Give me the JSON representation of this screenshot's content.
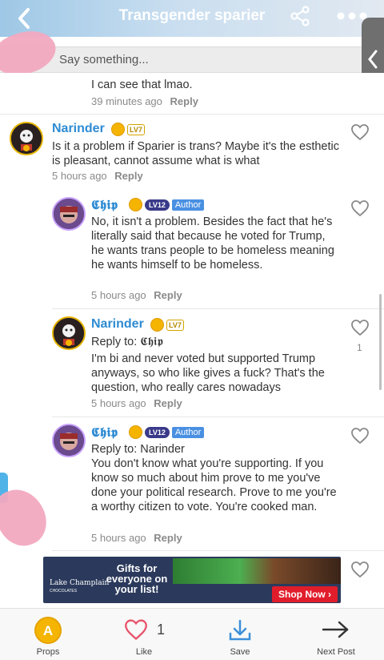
{
  "header": {
    "title": "Transgender sparier"
  },
  "composer": {
    "placeholder": "Say something..."
  },
  "comments": [
    {
      "text": "I can see that lmao.",
      "time": "39 minutes ago",
      "reply": "Reply"
    },
    {
      "username": "Narinder",
      "level": "LV7",
      "text": "Is it a problem if Sparier is trans? Maybe it's the esthetic is pleasant, cannot assume what is what",
      "time": "5 hours ago",
      "reply": "Reply"
    },
    {
      "username": "𝕮𝖍𝖎𝖕",
      "level": "LV12",
      "badge": "Author",
      "text": "No, it isn't a problem. Besides the fact that he's literally said that because he voted for Trump, he wants trans people to be homeless meaning he wants himself to be homeless.",
      "time": "5 hours ago",
      "reply": "Reply"
    },
    {
      "username": "Narinder",
      "level": "LV7",
      "reply_to": "Reply to: 𝕮𝖍𝖎𝖕",
      "text": "I'm bi and never voted but supported Trump anyways, so who like gives a fuck? That's the question, who really cares nowadays",
      "time": "5 hours ago",
      "reply": "Reply",
      "likes": "1"
    },
    {
      "username": "𝕮𝖍𝖎𝖕",
      "level": "LV12",
      "badge": "Author",
      "reply_to": "Reply to: Narinder",
      "text": "You don't know what you're supporting. If you know so much about him prove to me you've done your political research. Prove to me you're a worthy citizen to vote. You're cooked man.",
      "time": "5 hours ago",
      "reply": "Reply"
    }
  ],
  "ad": {
    "brand": "Lake Champlain",
    "brand_sub": "CHOCOLATES",
    "headline": "Gifts for everyone on your list!",
    "cta": "Shop Now ›"
  },
  "bottom_bar": {
    "props": "Props",
    "like": "Like",
    "like_count": "1",
    "save": "Save",
    "next": "Next Post"
  },
  "colors": {
    "username": "#2e8bd3",
    "author_badge": "#4a90e2",
    "coin": "#f4b400"
  }
}
